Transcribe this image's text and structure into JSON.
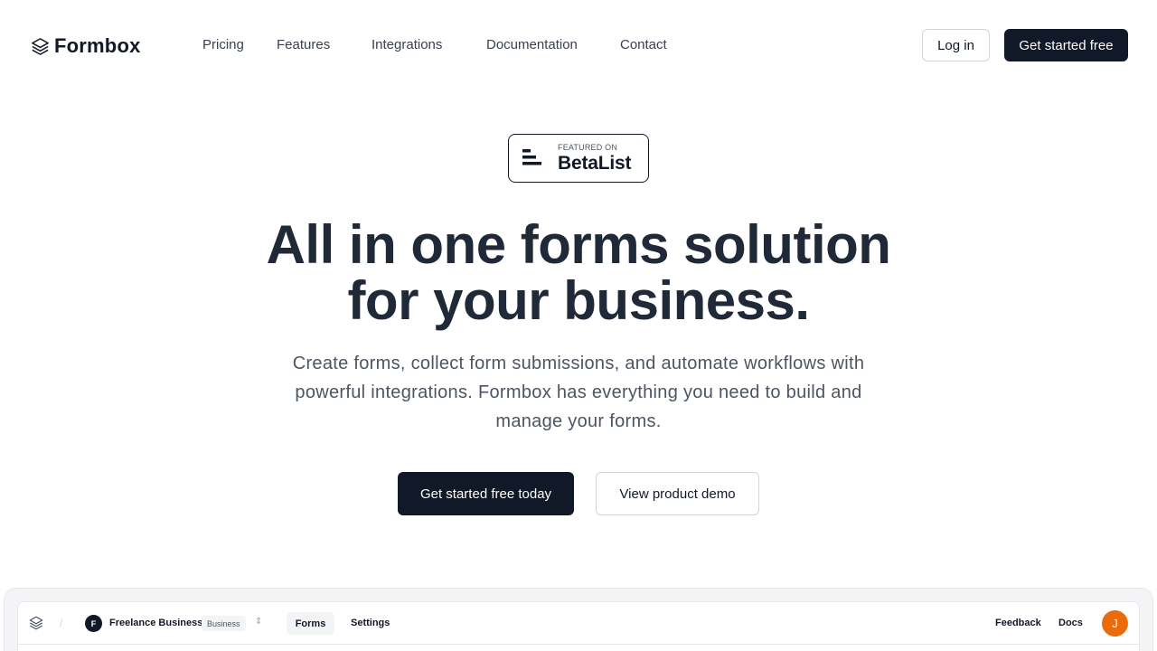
{
  "brand": {
    "name": "Formbox",
    "logo_icon": "stack-layers-icon"
  },
  "nav": {
    "links": [
      "Pricing",
      "Features",
      "Integrations",
      "Documentation",
      "Contact"
    ],
    "login_label": "Log in",
    "signup_label": "Get started free"
  },
  "badge": {
    "small": "FEATURED ON",
    "big": "BetaList",
    "icon": "betalist-icon"
  },
  "hero": {
    "title_line1": "All in one forms solution",
    "title_line2": "for your business.",
    "subtitle": "Create forms, collect form submissions, and automate workflows with powerful integrations. Formbox has everything you need to build and manage your forms.",
    "primary_cta": "Get started free today",
    "secondary_cta": "View product demo"
  },
  "preview": {
    "separator": "/",
    "workspace_initial": "F",
    "workspace_name": "Freelance Business",
    "workspace_plan": "Business",
    "tabs": [
      "Forms",
      "Settings"
    ],
    "right_links": [
      "Feedback",
      "Docs"
    ],
    "user_initial": "J"
  },
  "colors": {
    "primary": "#111827",
    "heading": "#1f2937",
    "body_text": "#4b5563",
    "avatar": "#ea6b0c"
  }
}
